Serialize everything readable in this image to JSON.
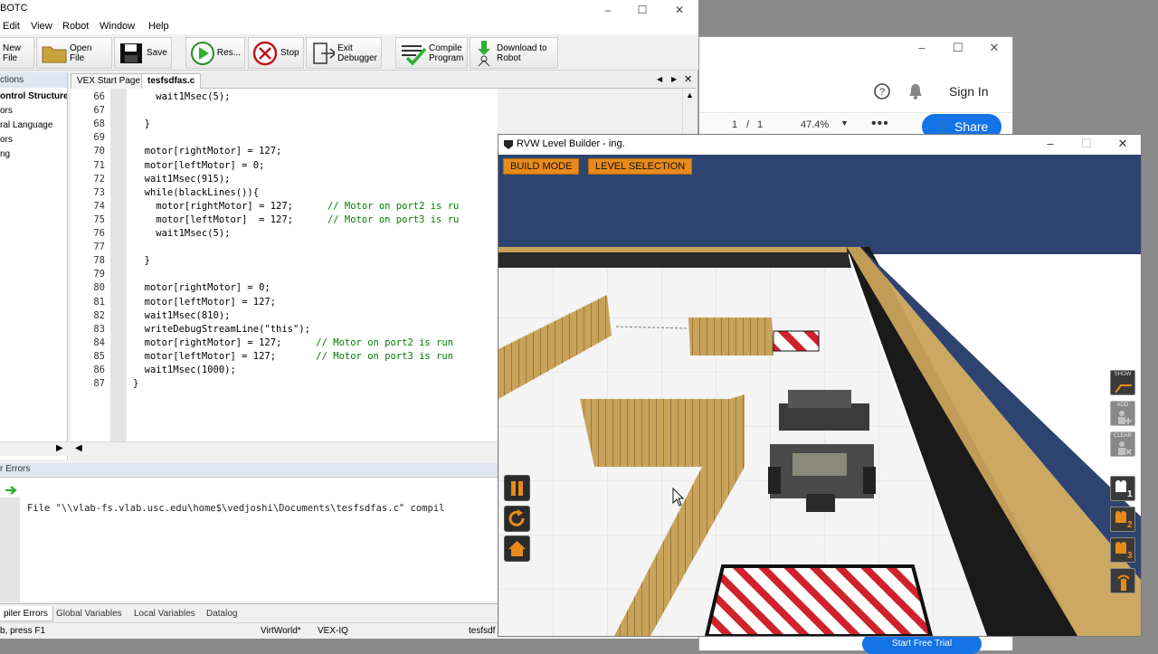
{
  "robotc": {
    "title": "BOTC",
    "menu": [
      "Edit",
      "View",
      "Robot",
      "Window",
      "Help"
    ],
    "toolbar": {
      "new_file": "New File",
      "open_file": "Open File",
      "save": "Save",
      "resume": "Res...",
      "stop": "Stop",
      "exit_debugger": "Exit Debugger",
      "compile": "Compile Program",
      "download": "Download to Robot"
    },
    "sidebar": {
      "header": "ctions",
      "items": [
        "ontrol Structure:",
        "ors",
        "ral Language",
        "ors",
        "ng"
      ]
    },
    "tabs": [
      "VEX Start Page",
      "tesfsdfas.c"
    ],
    "code_lines": [
      {
        "n": "66",
        "text": "    wait1Msec(5);",
        "comment": ""
      },
      {
        "n": "67",
        "text": "",
        "comment": ""
      },
      {
        "n": "68",
        "text": "  }",
        "comment": ""
      },
      {
        "n": "69",
        "text": "",
        "comment": ""
      },
      {
        "n": "70",
        "text": "  motor[rightMotor] = 127;",
        "comment": ""
      },
      {
        "n": "71",
        "text": "  motor[leftMotor] = 0;",
        "comment": ""
      },
      {
        "n": "72",
        "text": "  wait1Msec(915);",
        "comment": ""
      },
      {
        "n": "73",
        "text": "  while(blackLines()){",
        "comment": ""
      },
      {
        "n": "74",
        "text": "    motor[rightMotor] = 127;      ",
        "comment": "// Motor on port2 is ru"
      },
      {
        "n": "75",
        "text": "    motor[leftMotor]  = 127;      ",
        "comment": "// Motor on port3 is ru"
      },
      {
        "n": "76",
        "text": "    wait1Msec(5);",
        "comment": ""
      },
      {
        "n": "77",
        "text": "",
        "comment": ""
      },
      {
        "n": "78",
        "text": "  }",
        "comment": ""
      },
      {
        "n": "79",
        "text": "",
        "comment": ""
      },
      {
        "n": "80",
        "text": "  motor[rightMotor] = 0;",
        "comment": ""
      },
      {
        "n": "81",
        "text": "  motor[leftMotor] = 127;",
        "comment": ""
      },
      {
        "n": "82",
        "text": "  wait1Msec(810);",
        "comment": ""
      },
      {
        "n": "83",
        "text": "  writeDebugStreamLine(\"this\");",
        "comment": ""
      },
      {
        "n": "84",
        "text": "  motor[rightMotor] = 127;      ",
        "comment": "// Motor on port2 is run"
      },
      {
        "n": "85",
        "text": "  motor[leftMotor] = 127;       ",
        "comment": "// Motor on port3 is run"
      },
      {
        "n": "86",
        "text": "  wait1Msec(1000);",
        "comment": ""
      },
      {
        "n": "87",
        "text": "}",
        "comment": ""
      }
    ],
    "errors_header": "r Errors",
    "error_message": "File \"\\\\vlab-fs.vlab.usc.edu\\home$\\vedjoshi\\Documents\\tesfsdfas.c\" compil",
    "bottom_tabs": [
      "piler Errors",
      "Global Variables",
      "Local Variables",
      "Datalog"
    ],
    "status": {
      "help": "b, press F1",
      "world": "VirtWorld*",
      "platform": "VEX-IQ",
      "file": "tesfsdf"
    }
  },
  "pdf": {
    "sign_in": "Sign In",
    "page_current": "1",
    "page_sep": "/",
    "page_total": "1",
    "zoom": "47.4%",
    "share": "Share",
    "trial": "Start Free Trial"
  },
  "rvw": {
    "title": "RVW Level Builder - ing.",
    "build_mode": "BUILD MODE",
    "level_selection": "LEVEL SELECTION",
    "side_labels": {
      "show": "SHOW",
      "add": "ADD",
      "clear": "CLEAR"
    },
    "camera_numbers": [
      "1",
      "2",
      "3"
    ]
  },
  "colors": {
    "orange": "#e88b1c",
    "sky": "#2e4470",
    "share_blue": "#1473e6",
    "comment_green": "#007a00"
  }
}
